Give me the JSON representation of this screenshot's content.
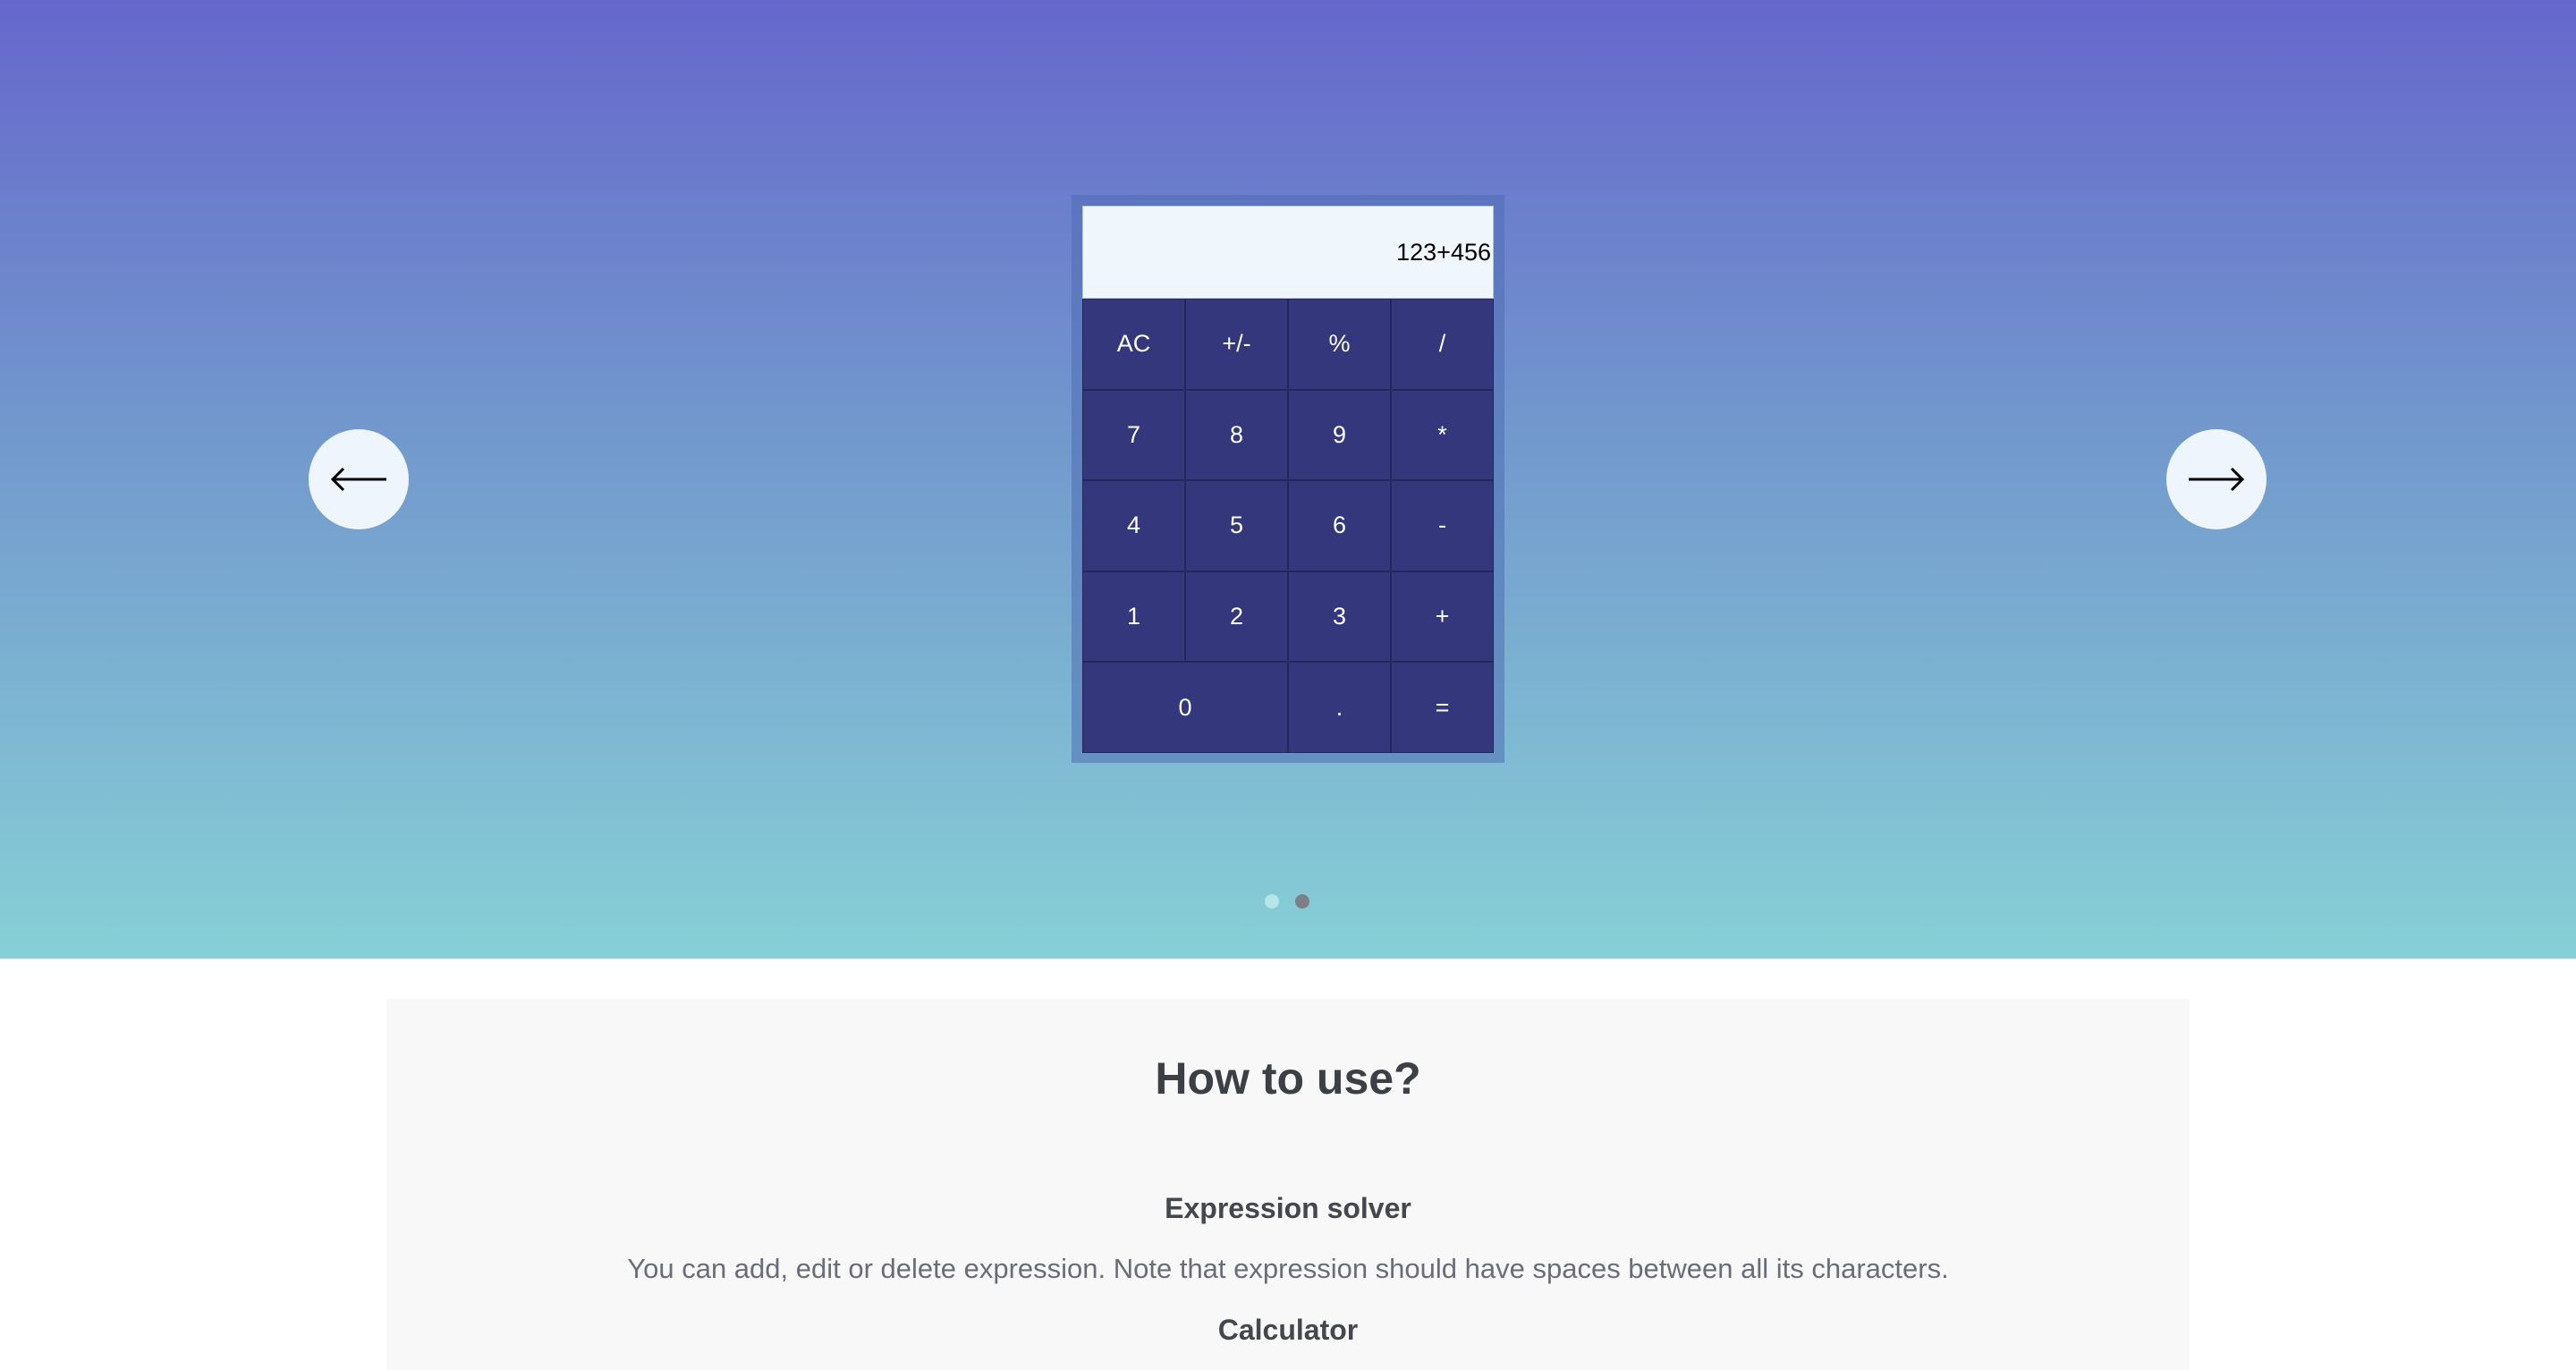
{
  "calculator": {
    "display": "123+456",
    "keys": [
      "AC",
      "+/-",
      "%",
      "/",
      "7",
      "8",
      "9",
      "*",
      "4",
      "5",
      "6",
      "-",
      "1",
      "2",
      "3",
      "+",
      "0",
      ".",
      "="
    ]
  },
  "carousel": {
    "prev_icon": "left-arrow-icon",
    "next_icon": "right-arrow-icon",
    "slides_count": 2,
    "active_slide": 1
  },
  "howto": {
    "title": "How to use?",
    "sections": [
      {
        "heading": "Expression solver",
        "text": "You can add, edit or delete expression. Note that expression should have spaces between all its characters."
      },
      {
        "heading": "Calculator"
      }
    ]
  },
  "colors": {
    "gradient_top": "#6667cc",
    "gradient_bottom": "#87d0d6",
    "key_background": "#35377d",
    "display_background": "#eff7fd"
  }
}
